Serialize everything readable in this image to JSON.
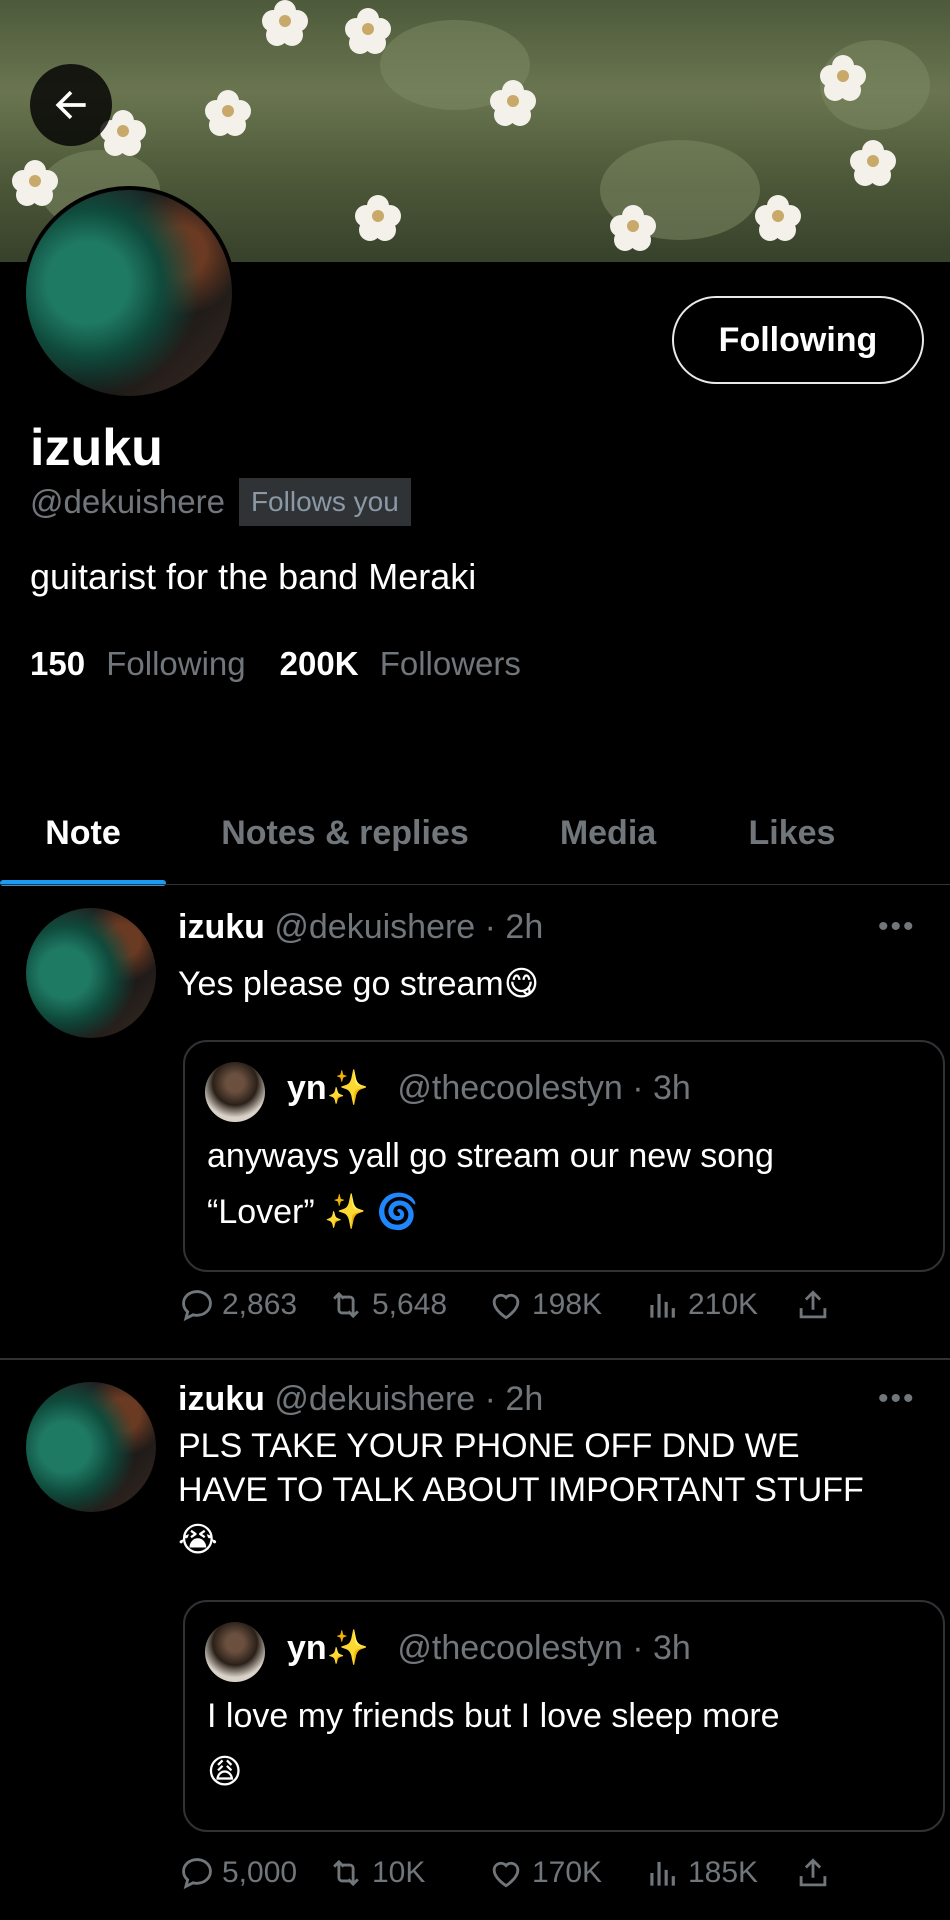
{
  "profile": {
    "name": "izuku",
    "handle": "@dekuishere",
    "follows_you": "Follows you",
    "bio": "guitarist for the band Meraki",
    "following_count": "150",
    "following_label": "Following",
    "followers_count": "200K",
    "followers_label": "Followers",
    "follow_button": "Following"
  },
  "tabs": [
    {
      "label": "Note",
      "active": true
    },
    {
      "label": "Notes & replies",
      "active": false
    },
    {
      "label": "Media",
      "active": false
    },
    {
      "label": "Likes",
      "active": false
    }
  ],
  "posts": [
    {
      "author": "izuku",
      "handle_time": "@dekuishere · 2h",
      "more": "•••",
      "text": "Yes please go stream",
      "emoji": "😋",
      "quote": {
        "author": "yn",
        "author_emoji": "✨",
        "handle_time": "@thecoolestyn · 3h",
        "line1": "anyways yall go stream our new song",
        "line2": "“Lover” ",
        "emoji1": "✨",
        "emoji2": "🌀"
      },
      "replies": "2,863",
      "reposts": "5,648",
      "likes": "198K",
      "views": "210K"
    },
    {
      "author": "izuku",
      "handle_time": "@dekuishere · 2h",
      "more": "•••",
      "line1": "PLS  TAKE YOUR PHONE OFF DND WE",
      "line2": "HAVE TO TALK ABOUT IMPORTANT STUFF",
      "emoji": "😭",
      "quote": {
        "author": "yn",
        "author_emoji": "✨",
        "handle_time": "@thecoolestyn · 3h",
        "line1": "I love my friends but I love sleep more",
        "emoji": "😩"
      },
      "replies": "5,000",
      "reposts": "10K",
      "likes": "170K",
      "views": "185K"
    }
  ],
  "colors": {
    "background": "#000000",
    "accent": "#1d9bf0",
    "muted": "#71767b",
    "border": "#2f3336"
  },
  "icons": [
    "back-arrow-icon",
    "more-icon",
    "reply-icon",
    "repost-icon",
    "like-icon",
    "views-icon",
    "share-icon"
  ]
}
